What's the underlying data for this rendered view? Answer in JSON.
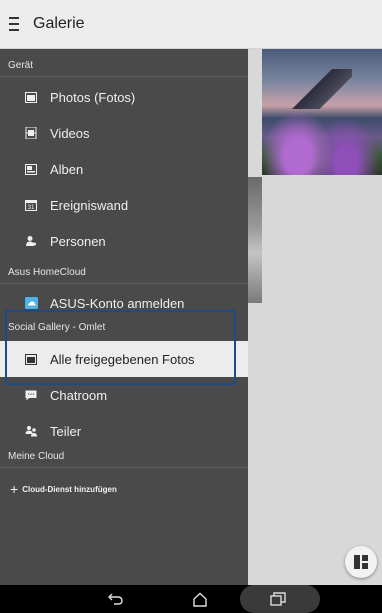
{
  "appbar": {
    "title": "Galerie"
  },
  "drawer": {
    "section_device": "Gerät",
    "device_items": [
      {
        "label": "Photos (Fotos)",
        "icon": "photos-icon"
      },
      {
        "label": "Videos",
        "icon": "film-icon"
      },
      {
        "label": "Alben",
        "icon": "album-icon"
      },
      {
        "label": "Ereigniswand",
        "icon": "calendar-icon"
      },
      {
        "label": "Personen",
        "icon": "person-icon"
      }
    ],
    "section_homecloud": "Asus HomeCloud",
    "homecloud_items": [
      {
        "label": "ASUS-Konto anmelden",
        "icon": "cloud-icon"
      }
    ],
    "section_social": "Social Gallery - Omlet",
    "social_items": [
      {
        "label": "Alle freigegebenen Fotos",
        "icon": "shared-photos-icon",
        "selected": true
      },
      {
        "label": "Chatroom",
        "icon": "chat-icon"
      },
      {
        "label": "Teiler",
        "icon": "sharers-icon"
      }
    ],
    "section_mycloud": "Meine Cloud",
    "add_cloud": "Cloud-Dienst hinzufügen",
    "add_cloud_plus": "+"
  },
  "colors": {
    "drawer_bg": "#4a4a4a",
    "selected_bg": "#ececec",
    "highlight_border": "#1e4a8a"
  }
}
